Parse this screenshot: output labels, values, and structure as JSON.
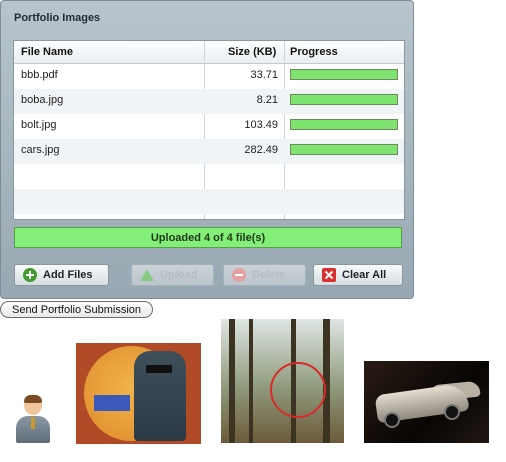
{
  "panel": {
    "title": "Portfolio Images",
    "columns": {
      "file_name": "File Name",
      "size": "Size (KB)",
      "progress": "Progress"
    },
    "files": [
      {
        "name": "bbb.pdf",
        "size": "33.71",
        "progress": 1.0
      },
      {
        "name": "boba.jpg",
        "size": "8.21",
        "progress": 1.0
      },
      {
        "name": "bolt.jpg",
        "size": "103.49",
        "progress": 1.0
      },
      {
        "name": "cars.jpg",
        "size": "282.49",
        "progress": 1.0
      }
    ],
    "status_text": "Uploaded 4 of 4 file(s)",
    "overall_progress": 1.0,
    "buttons": {
      "add_files": "Add Files",
      "upload": "Upload",
      "delete": "Delete",
      "clear_all": "Clear All"
    }
  },
  "send_button": "Send Portfolio Submission",
  "colors": {
    "progress_fill": "#7fe46f",
    "panel_bg": "#a7b6bf",
    "clear_icon": "#d82f2f",
    "add_icon": "#3f9b2e"
  },
  "thumbnails": [
    {
      "name": "avatar-thumbnail",
      "icon": "user-avatar-icon"
    },
    {
      "name": "boba-thumbnail"
    },
    {
      "name": "bigfoot-thumbnail"
    },
    {
      "name": "cars-thumbnail"
    }
  ]
}
